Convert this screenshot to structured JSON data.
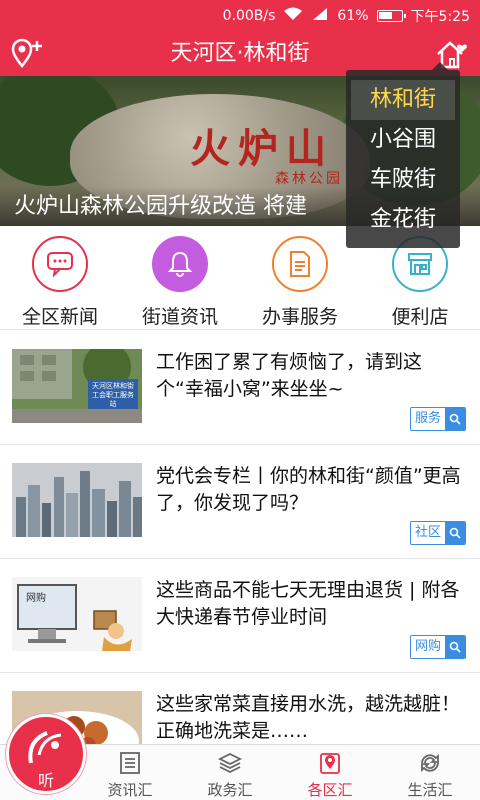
{
  "status_bar": {
    "network_speed": "0.00B/s",
    "battery": "61%",
    "battery_level": 0.61,
    "time": "下午5:25"
  },
  "header": {
    "title": "天河区·林和街",
    "left_icon": "location-add-icon",
    "right_icon": "home-heart-icon",
    "accent": "#e8304a"
  },
  "banner": {
    "caption": "火炉山森林公园升级改造 将建",
    "rock_text": "火炉山",
    "rock_sub": "森林公园"
  },
  "street_menu": {
    "options": [
      "林和街",
      "小谷围",
      "车陂街",
      "金花街"
    ],
    "selected_color": "#ffd84a"
  },
  "categories": [
    {
      "label": "全区新闻",
      "icon": "chat-bubble-icon",
      "color": "#e8304a"
    },
    {
      "label": "街道资讯",
      "icon": "bell-icon",
      "color": "#c45ce0"
    },
    {
      "label": "办事服务",
      "icon": "document-icon",
      "color": "#f08030"
    },
    {
      "label": "便利店",
      "icon": "store-icon",
      "color": "#3ab0c8"
    }
  ],
  "news": [
    {
      "title": "工作困了累了有烦恼了，请到这个“幸福小窝”来坐坐~",
      "tag": "服务"
    },
    {
      "title": "党代会专栏丨你的林和街“颜值”更高了，你发现了吗？",
      "tag": "社区"
    },
    {
      "title": "这些商品不能七天无理由退货 | 附各大快递春节停业时间",
      "tag": "网购"
    },
    {
      "title": "这些家常菜直接用水洗，越洗越脏！正确地洗菜是……",
      "tag": ""
    }
  ],
  "thumb_texts": {
    "sign": "天河区林和街工会职工服务站",
    "shopping": "网购"
  },
  "bottom_nav": {
    "listen": "听",
    "items": [
      {
        "label": "资讯汇",
        "icon": "news-icon"
      },
      {
        "label": "政务汇",
        "icon": "layers-icon"
      },
      {
        "label": "各区汇",
        "icon": "map-pin-icon",
        "active": true
      },
      {
        "label": "生活汇",
        "icon": "refresh-arrows-icon"
      }
    ]
  }
}
